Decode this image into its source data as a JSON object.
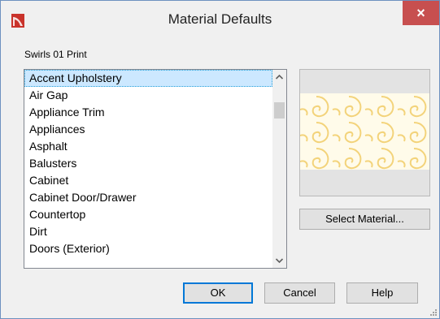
{
  "window": {
    "title": "Material Defaults",
    "close_glyph": "×",
    "app_icon": "chief-architect-logo-icon"
  },
  "material": {
    "name": "Swirls 01 Print"
  },
  "list": {
    "selected_index": 0,
    "items": [
      "Accent Upholstery",
      "Air Gap",
      "Appliance Trim",
      "Appliances",
      "Asphalt",
      "Balusters",
      "Cabinet",
      "Cabinet Door/Drawer",
      "Countertop",
      "Dirt",
      "Doors (Exterior)"
    ]
  },
  "preview": {
    "pattern_color": "#f3d37a",
    "background_color": "#fffbea"
  },
  "buttons": {
    "select_material": "Select Material...",
    "ok": "OK",
    "cancel": "Cancel",
    "help": "Help"
  },
  "colors": {
    "close_button": "#c74f4f",
    "selection": "#cce8ff",
    "default_button_border": "#0078d7"
  }
}
